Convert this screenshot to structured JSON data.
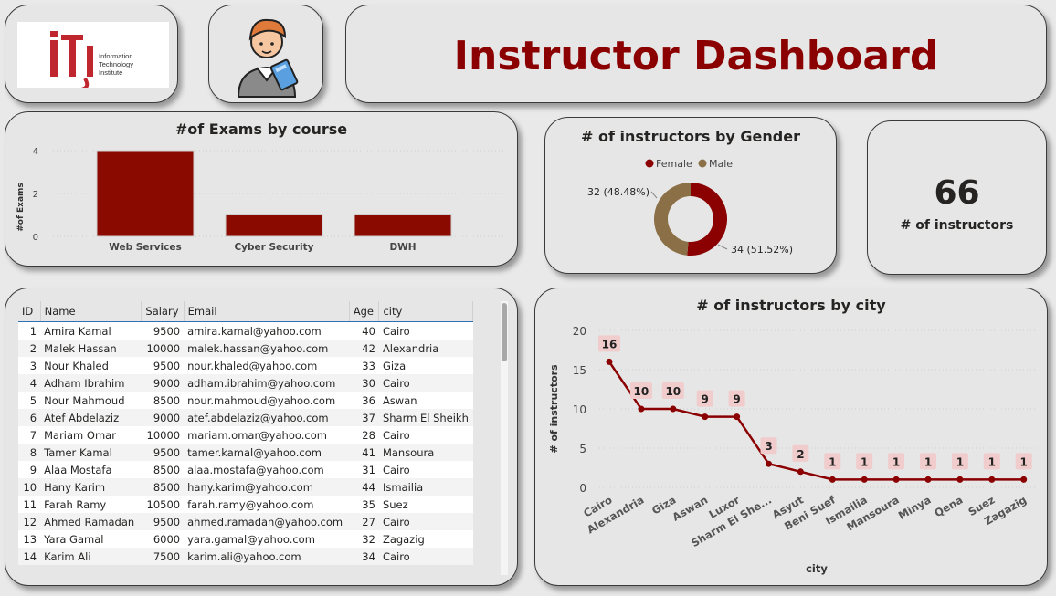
{
  "logo": {
    "line1": "Information",
    "line2": "Technology",
    "line3": "Institute"
  },
  "header": {
    "title": "Instructor Dashboard"
  },
  "kpi": {
    "value": "66",
    "label": "# of instructors"
  },
  "colors": {
    "primary": "#8b0000",
    "male": "#8b6f47",
    "label_bg": "#f0cccc"
  },
  "table": {
    "columns": [
      "ID",
      "Name",
      "Salary",
      "Email",
      "Age",
      "city"
    ],
    "rows": [
      [
        "1",
        "Amira Kamal",
        "9500",
        "amira.kamal@yahoo.com",
        "40",
        "Cairo"
      ],
      [
        "2",
        "Malek Hassan",
        "10000",
        "malek.hassan@yahoo.com",
        "42",
        "Alexandria"
      ],
      [
        "3",
        "Nour Khaled",
        "9500",
        "nour.khaled@yahoo.com",
        "33",
        "Giza"
      ],
      [
        "4",
        "Adham Ibrahim",
        "9000",
        "adham.ibrahim@yahoo.com",
        "30",
        "Cairo"
      ],
      [
        "5",
        "Nour Mahmoud",
        "8500",
        "nour.mahmoud@yahoo.com",
        "36",
        "Aswan"
      ],
      [
        "6",
        "Atef Abdelaziz",
        "9000",
        "atef.abdelaziz@yahoo.com",
        "37",
        "Sharm El Sheikh"
      ],
      [
        "7",
        "Mariam Omar",
        "10000",
        "mariam.omar@yahoo.com",
        "28",
        "Cairo"
      ],
      [
        "8",
        "Tamer Kamal",
        "9500",
        "tamer.kamal@yahoo.com",
        "41",
        "Mansoura"
      ],
      [
        "9",
        "Alaa Mostafa",
        "8500",
        "alaa.mostafa@yahoo.com",
        "31",
        "Cairo"
      ],
      [
        "10",
        "Hany Karim",
        "8500",
        "hany.karim@yahoo.com",
        "44",
        "Ismailia"
      ],
      [
        "11",
        "Farah Ramy",
        "10500",
        "farah.ramy@yahoo.com",
        "35",
        "Suez"
      ],
      [
        "12",
        "Ahmed Ramadan",
        "9500",
        "ahmed.ramadan@yahoo.com",
        "27",
        "Cairo"
      ],
      [
        "13",
        "Yara Gamal",
        "6000",
        "yara.gamal@yahoo.com",
        "32",
        "Zagazig"
      ],
      [
        "14",
        "Karim Ali",
        "7500",
        "karim.ali@yahoo.com",
        "34",
        "Cairo"
      ]
    ]
  },
  "chart_data": [
    {
      "type": "bar",
      "title": "#of Exams by course",
      "xlabel": "",
      "ylabel": "#of Exams",
      "categories": [
        "Web Services",
        "Cyber Security",
        "DWH"
      ],
      "values": [
        4,
        1,
        1
      ],
      "ylim": [
        0,
        4
      ],
      "yticks": [
        0,
        2,
        4
      ]
    },
    {
      "type": "pie",
      "title": "# of instructors by Gender",
      "legend": [
        "Female",
        "Male"
      ],
      "legend_position": "top",
      "series": [
        {
          "name": "Female",
          "value": 34,
          "label": "34 (51.52%)"
        },
        {
          "name": "Male",
          "value": 32,
          "label": "32 (48.48%)"
        }
      ]
    },
    {
      "type": "line",
      "title": "# of instructors by city",
      "xlabel": "city",
      "ylabel": "# of instructors",
      "categories": [
        "Cairo",
        "Alexandria",
        "Giza",
        "Aswan",
        "Luxor",
        "Sharm El She...",
        "Asyut",
        "Beni Suef",
        "Ismailia",
        "Mansoura",
        "Minya",
        "Qena",
        "Suez",
        "Zagazig"
      ],
      "values": [
        16,
        10,
        10,
        9,
        9,
        3,
        2,
        1,
        1,
        1,
        1,
        1,
        1,
        1
      ],
      "ylim": [
        0,
        20
      ],
      "yticks": [
        0,
        5,
        10,
        15,
        20
      ],
      "grid": true
    }
  ]
}
